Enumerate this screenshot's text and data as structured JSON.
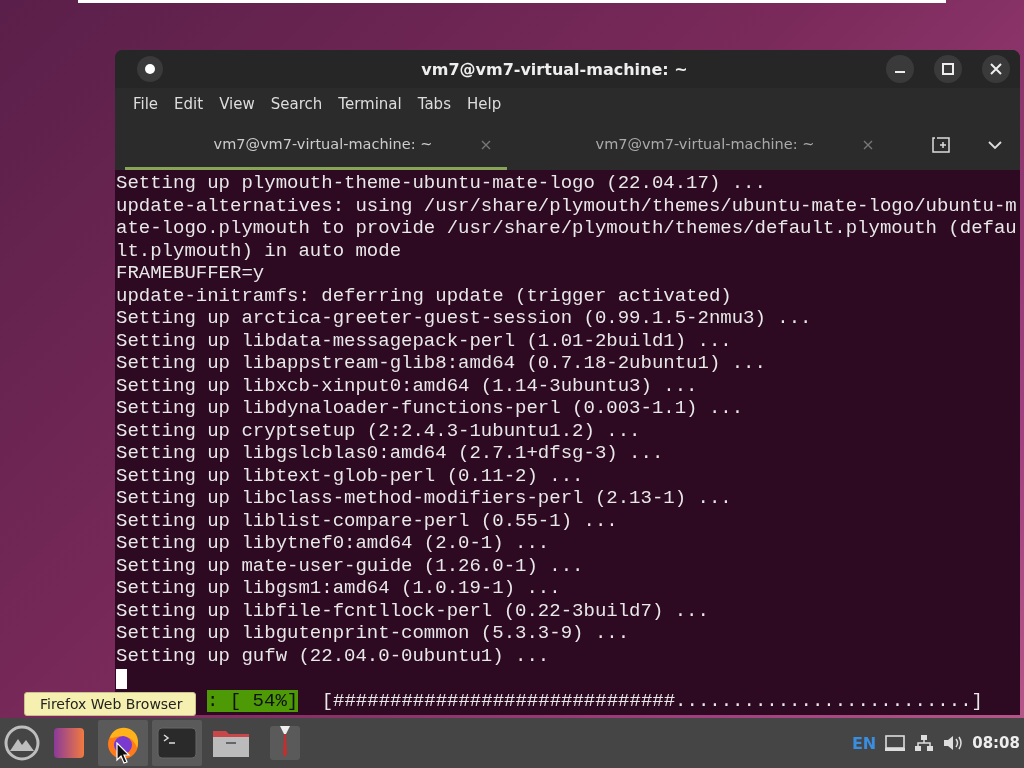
{
  "window": {
    "title": "vm7@vm7-virtual-machine: ~"
  },
  "menu": [
    "File",
    "Edit",
    "View",
    "Search",
    "Terminal",
    "Tabs",
    "Help"
  ],
  "tabs": [
    {
      "label": "vm7@vm7-virtual-machine: ~",
      "selected": true
    },
    {
      "label": "vm7@vm7-virtual-machine: ~",
      "selected": false
    }
  ],
  "terminal": {
    "lines": [
      "Setting up plymouth-theme-ubuntu-mate-logo (22.04.17) ...",
      "update-alternatives: using /usr/share/plymouth/themes/ubuntu-mate-logo/ubuntu-m",
      "ate-logo.plymouth to provide /usr/share/plymouth/themes/default.plymouth (defau",
      "lt.plymouth) in auto mode",
      "FRAMEBUFFER=y",
      "update-initramfs: deferring update (trigger activated)",
      "Setting up arctica-greeter-guest-session (0.99.1.5-2nmu3) ...",
      "Setting up libdata-messagepack-perl (1.01-2build1) ...",
      "Setting up libappstream-glib8:amd64 (0.7.18-2ubuntu1) ...",
      "Setting up libxcb-xinput0:amd64 (1.14-3ubuntu3) ...",
      "Setting up libdynaloader-functions-perl (0.003-1.1) ...",
      "Setting up cryptsetup (2:2.4.3-1ubuntu1.2) ...",
      "Setting up libgslcblas0:amd64 (2.7.1+dfsg-3) ...",
      "Setting up libtext-glob-perl (0.11-2) ...",
      "Setting up libclass-method-modifiers-perl (2.13-1) ...",
      "Setting up liblist-compare-perl (0.55-1) ...",
      "Setting up libytnef0:amd64 (2.0-1) ...",
      "Setting up mate-user-guide (1.26.0-1) ...",
      "Setting up libgsm1:amd64 (1.0.19-1) ...",
      "Setting up libfile-fcntllock-perl (0.22-3build7) ...",
      "Setting up libgutenprint-common (5.3.3-9) ...",
      "Setting up gufw (22.04.0-0ubuntu1) ..."
    ],
    "progress_status": ": [ 54%]",
    "progress_bar": "[##############################..........................]"
  },
  "tooltip": "Firefox Web Browser",
  "taskbar": {
    "apps": [
      {
        "kind": "menu",
        "selected": false
      },
      {
        "kind": "app",
        "selected": false
      },
      {
        "kind": "firefox",
        "selected": true
      },
      {
        "kind": "terminal",
        "selected": true
      },
      {
        "kind": "files",
        "selected": false
      },
      {
        "kind": "suit",
        "selected": false
      }
    ],
    "keyboard_layout": "EN",
    "clock": "08:08"
  }
}
